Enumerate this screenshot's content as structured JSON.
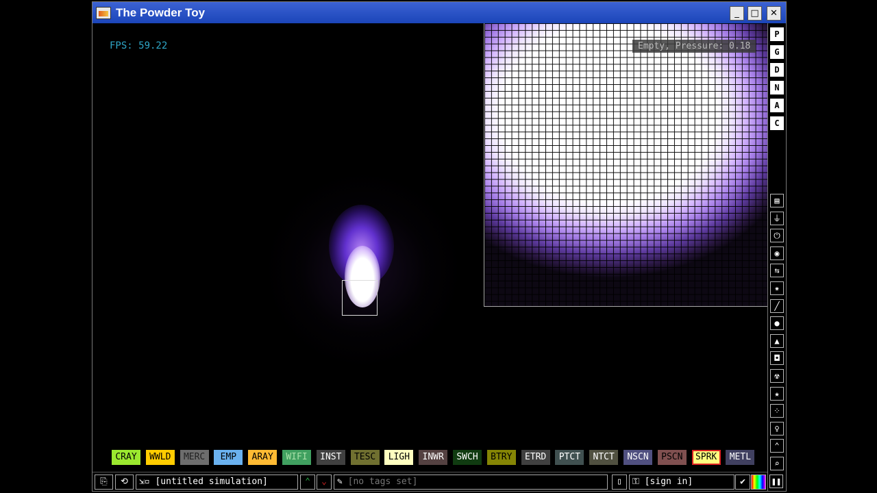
{
  "window": {
    "title": "The Powder Toy"
  },
  "window_controls": {
    "minimize": "_",
    "maximize": "□",
    "close": "✕"
  },
  "sim": {
    "fps": "FPS: 59.22",
    "hud_info": "Empty, Pressure: 0.18"
  },
  "right_menu": {
    "letters": [
      "P",
      "G",
      "D",
      "N",
      "A",
      "C"
    ],
    "categories": [
      {
        "name": "walls-icon",
        "glyph": "▤"
      },
      {
        "name": "electronics-icon",
        "glyph": "⏚"
      },
      {
        "name": "power-icon",
        "glyph": "⏻"
      },
      {
        "name": "sensors-icon",
        "glyph": "◉"
      },
      {
        "name": "force-icon",
        "glyph": "⇆"
      },
      {
        "name": "explosives-icon",
        "glyph": "✷"
      },
      {
        "name": "solids-icon",
        "glyph": "╱"
      },
      {
        "name": "liquids-icon",
        "glyph": "●"
      },
      {
        "name": "powders-icon",
        "glyph": "▲"
      },
      {
        "name": "gases-icon",
        "glyph": "◘"
      },
      {
        "name": "radioactive-icon",
        "glyph": "☢"
      },
      {
        "name": "special-icon",
        "glyph": "★"
      },
      {
        "name": "particles-icon",
        "glyph": "⁘"
      },
      {
        "name": "life-icon",
        "glyph": "♀"
      },
      {
        "name": "tools-icon",
        "glyph": "⌃"
      },
      {
        "name": "search-icon",
        "glyph": "⌕"
      }
    ]
  },
  "elements": [
    {
      "label": "CRAY",
      "bg": "#9be82f",
      "fg": "#000000"
    },
    {
      "label": "WWLD",
      "bg": "#ffcc00",
      "fg": "#000000"
    },
    {
      "label": "MERC",
      "bg": "#6d6d6d",
      "fg": "#222222"
    },
    {
      "label": "EMP",
      "bg": "#6ab1ef",
      "fg": "#000000"
    },
    {
      "label": "ARAY",
      "bg": "#ffba33",
      "fg": "#000000"
    },
    {
      "label": "WIFI",
      "bg": "#40a060",
      "fg": "#a8e0a8"
    },
    {
      "label": "INST",
      "bg": "#404040",
      "fg": "#ffffff"
    },
    {
      "label": "TESC",
      "bg": "#707030",
      "fg": "#000000"
    },
    {
      "label": "LIGH",
      "bg": "#ffffc0",
      "fg": "#000000"
    },
    {
      "label": "INWR",
      "bg": "#544141",
      "fg": "#ffffff"
    },
    {
      "label": "SWCH",
      "bg": "#103b11",
      "fg": "#ffffff"
    },
    {
      "label": "BTRY",
      "bg": "#858505",
      "fg": "#000000"
    },
    {
      "label": "ETRD",
      "bg": "#404040",
      "fg": "#ffffff"
    },
    {
      "label": "PTCT",
      "bg": "#405050",
      "fg": "#ffffff"
    },
    {
      "label": "NTCT",
      "bg": "#505040",
      "fg": "#ffffff"
    },
    {
      "label": "NSCN",
      "bg": "#505080",
      "fg": "#ffffff"
    },
    {
      "label": "PSCN",
      "bg": "#805050",
      "fg": "#000000"
    },
    {
      "label": "SPRK",
      "bg": "#ffff80",
      "fg": "#000000",
      "selected": true
    },
    {
      "label": "METL",
      "bg": "#404060",
      "fg": "#ffffff"
    }
  ],
  "bottombar": {
    "save_name": "[untitled simulation]",
    "tags": "[no tags set]",
    "sign_in": "[sign in]"
  }
}
